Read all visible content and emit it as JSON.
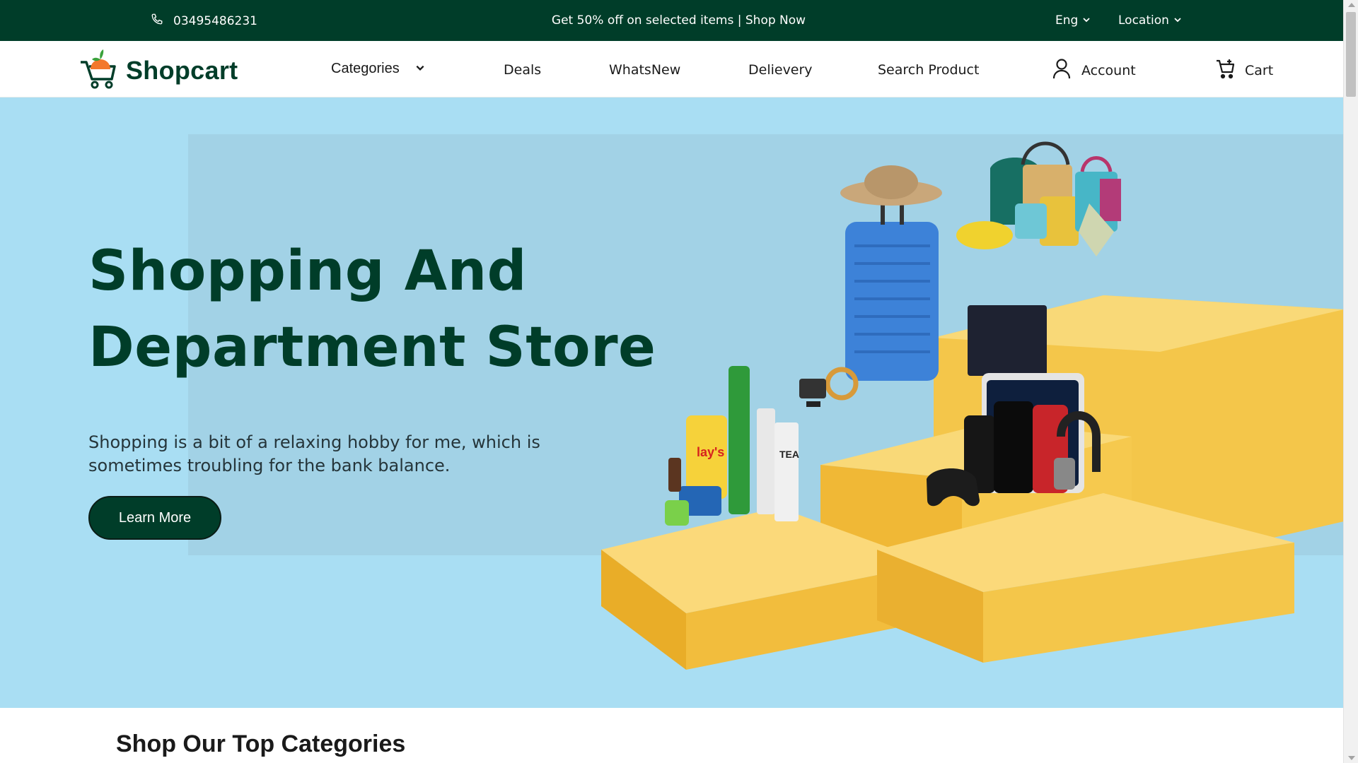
{
  "topbar": {
    "phone": "03495486231",
    "promo": "Get 50% off on selected items | Shop Now",
    "language": "Eng",
    "location": "Location"
  },
  "nav": {
    "brand": "Shopcart",
    "categories": "Categories",
    "deals": "Deals",
    "whats_new": "WhatsNew",
    "delivery": "Delievery",
    "search": "Search Product",
    "account": "Account",
    "cart": "Cart"
  },
  "hero": {
    "title_line1": "Shopping And",
    "title_line2": "Department Store",
    "subtitle": "Shopping is a bit of a relaxing hobby for me, which is sometimes troubling for the bank balance.",
    "cta": "Learn More"
  },
  "section": {
    "title": "Shop Our Top Categories"
  },
  "colors": {
    "brand_green": "#003d29",
    "hero_bg": "#a9def3",
    "pedestal": "#f6c94e"
  },
  "icons": [
    "phone-icon",
    "chevron-down-icon",
    "cart-logo-icon",
    "user-icon",
    "cart-icon"
  ]
}
